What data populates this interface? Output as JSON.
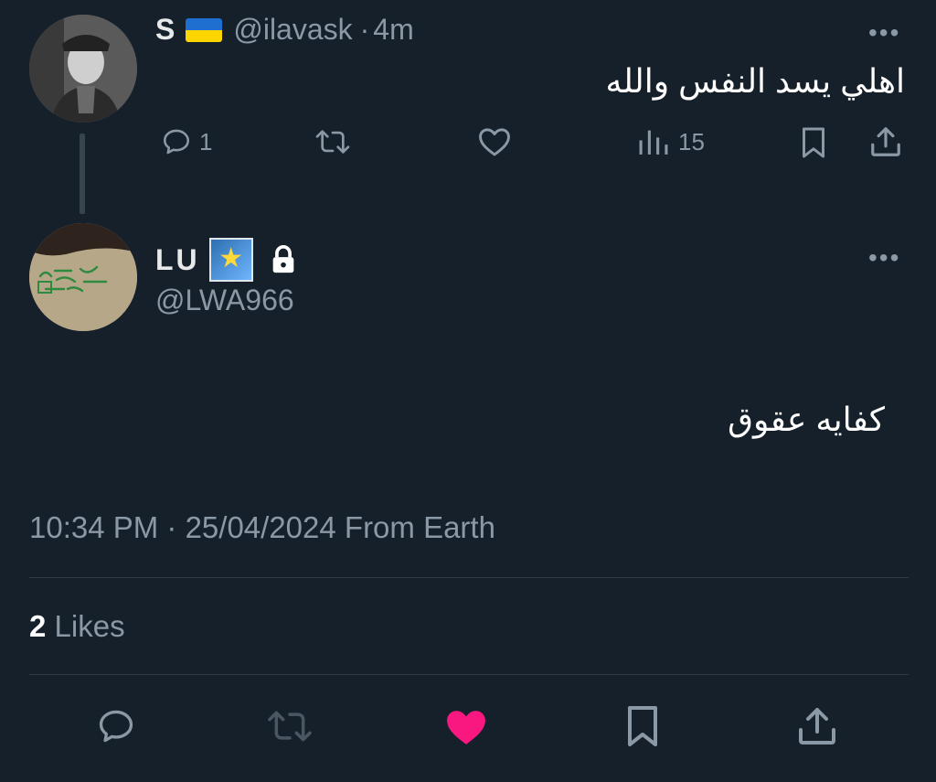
{
  "parent_tweet": {
    "display_name": "S",
    "flag_icon": "ukraine-flag-icon",
    "handle": "@ilavask",
    "separator": "·",
    "time_ago": "4m",
    "text": "اهلي يسد النفس والله",
    "replies_count": "1",
    "views_count": "15"
  },
  "main_tweet": {
    "display_name": "LU",
    "badge_icon": "star-badge-icon",
    "lock_icon": "lock-icon",
    "handle": "@LWA966",
    "text": "كفايه عقوق",
    "timestamp": "10:34 PM · 25/04/2024 From Earth",
    "likes_count": "2",
    "likes_label": "Likes"
  },
  "colors": {
    "background": "#15202b",
    "text_primary": "#e7e9ea",
    "text_secondary": "#8b98a5",
    "like_active": "#f91880",
    "flag_blue": "#1f6fd1",
    "flag_yellow": "#ffd500"
  }
}
